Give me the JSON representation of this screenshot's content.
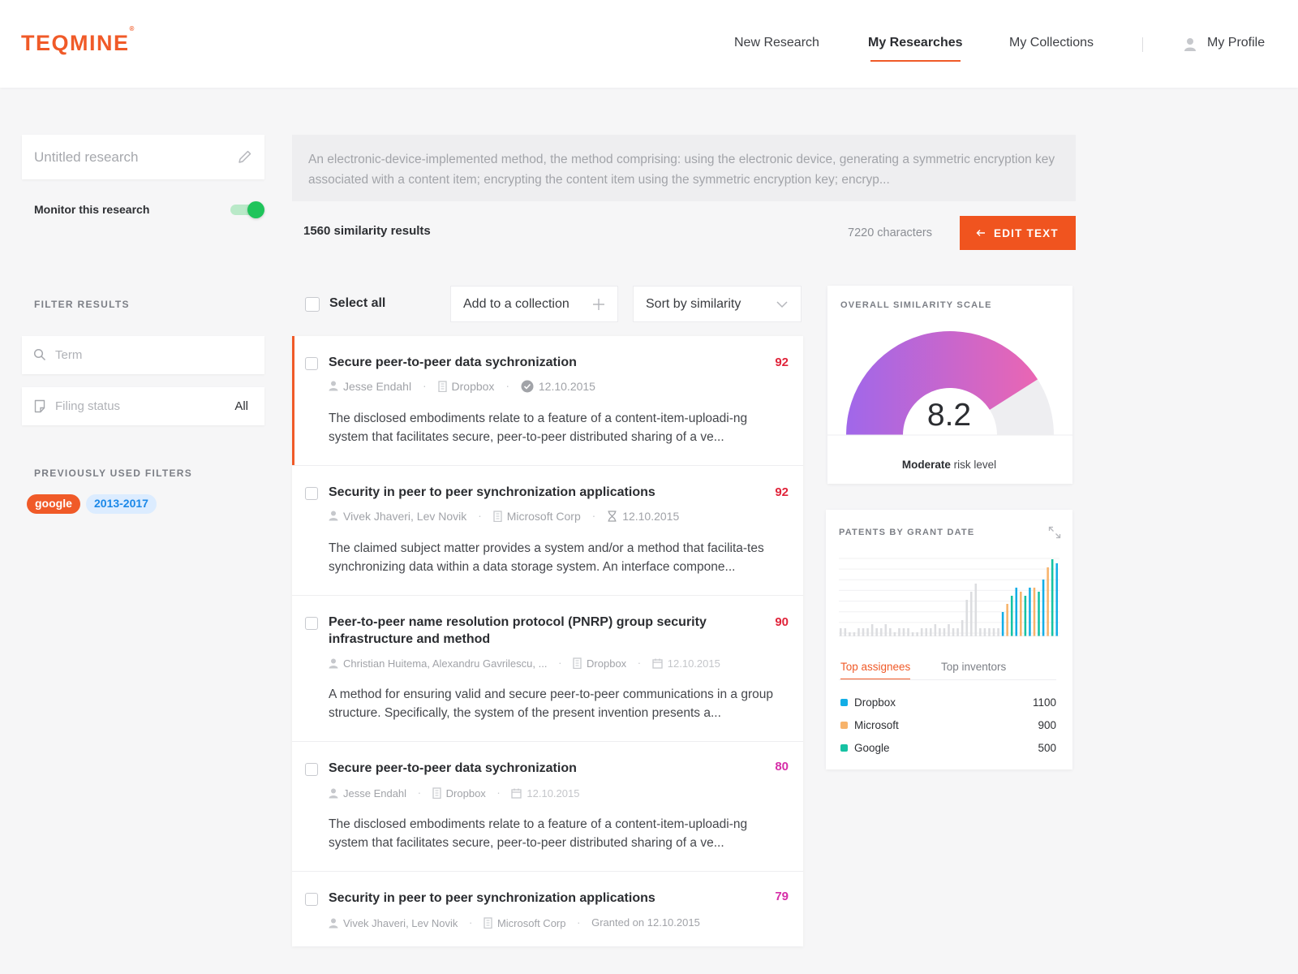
{
  "header": {
    "logo": "TEQMINE",
    "logo_mark": "®",
    "nav": [
      {
        "label": "New Research"
      },
      {
        "label": "My Researches"
      },
      {
        "label": "My Collections"
      },
      {
        "label": "My Profile"
      }
    ]
  },
  "sidebar": {
    "research_title_placeholder": "Untitled research",
    "monitor_label": "Monitor this research",
    "monitor_enabled": true,
    "filter_heading": "FILTER RESULTS",
    "term_placeholder": "Term",
    "filing_status_label": "Filing status",
    "filing_status_value": "All",
    "previous_filters_heading": "PREVIOUSLY USED FILTERS",
    "previous_filters": [
      "google",
      "2013-2017"
    ]
  },
  "query": {
    "text": "An electronic-device-implemented method, the method comprising: using the electronic device, generating a symmetric encryption key associated with a content item; encrypting the content item using the symmetric encryption key; encryp...",
    "results_count": "1560 similarity results",
    "characters": "7220 characters",
    "edit_button": "EDIT TEXT"
  },
  "toolbar": {
    "select_all": "Select all",
    "add_to_collection": "Add to a collection",
    "sort": "Sort by similarity"
  },
  "results": [
    {
      "title": "Secure peer-to-peer data sychronization",
      "score": "92",
      "authors": "Jesse Endahl",
      "company": "Dropbox",
      "date": "12.10.2015",
      "description": "The disclosed embodiments relate to a feature of a content-item-uploadi-ng system that facilitates secure, peer-to-peer distributed sharing of a ve..."
    },
    {
      "title": "Security in peer to peer synchronization applications",
      "score": "92",
      "authors": "Vivek Jhaveri, Lev Novik",
      "company": "Microsoft Corp",
      "date": "12.10.2015",
      "description": "The claimed subject matter provides a system and/or a method that facilita-tes synchronizing data within a data storage system. An interface compone..."
    },
    {
      "title": "Peer-to-peer name resolution protocol (PNRP) group security infrastructure and method",
      "score": "90",
      "authors": "Christian Huitema, Alexandru Gavrilescu, ...",
      "company": "Dropbox",
      "date": "12.10.2015",
      "description": "A method for ensuring valid and secure peer-to-peer communications in a group structure. Specifically, the system of the present invention presents a..."
    },
    {
      "title": "Secure peer-to-peer data sychronization",
      "score": "80",
      "authors": "Jesse Endahl",
      "company": "Dropbox",
      "date": "12.10.2015",
      "description": "The disclosed embodiments relate to a feature of a content-item-uploadi-ng system that facilitates secure, peer-to-peer distributed sharing of a ve..."
    },
    {
      "title": "Security in peer to peer synchronization applications",
      "score": "79",
      "authors": "Vivek Jhaveri, Lev Novik",
      "company": "Microsoft Corp",
      "date": "Granted on 12.10.2015",
      "description": ""
    }
  ],
  "similarity_card": {
    "title": "OVERALL SIMILARITY SCALE",
    "value": "8.2",
    "scale_max": 10,
    "risk_word": "Moderate",
    "risk_suffix": " risk level"
  },
  "patents_card": {
    "title": "PATENTS BY GRANT DATE",
    "tabs": [
      "Top assignees",
      "Top inventors"
    ],
    "assignees": [
      {
        "name": "Dropbox",
        "value": "1100",
        "color": "#13aee6"
      },
      {
        "name": "Microsoft",
        "value": "900",
        "color": "#f7b36b"
      },
      {
        "name": "Google",
        "value": "500",
        "color": "#16c2a3"
      }
    ]
  },
  "colors": {
    "accent": "#f05a28",
    "score_red": "#e0243a",
    "score_pink": "#d62ea8",
    "gauge_start": "#a067ea",
    "gauge_end": "#ea66b3"
  },
  "chart_data": {
    "type": "bar",
    "series": [
      {
        "values": [
          1,
          1,
          0.5,
          0.5,
          1,
          1,
          1,
          1.5,
          1,
          1,
          1.5,
          1,
          0.5,
          1,
          1,
          1,
          0.5,
          0.5,
          1,
          1,
          1,
          1.5,
          1,
          1,
          1.5,
          1,
          1,
          2,
          4.5,
          5.5,
          6.5,
          1,
          1,
          1,
          1,
          1,
          1,
          1
        ]
      },
      {
        "values": [
          0,
          0,
          0,
          0,
          0,
          0,
          0,
          0,
          0,
          0,
          0,
          0,
          0,
          0,
          0,
          0,
          0,
          0,
          0,
          0,
          0,
          0,
          0,
          0,
          0,
          0,
          0,
          0,
          0,
          0,
          0,
          0,
          0,
          0,
          0,
          0,
          3,
          4,
          5,
          6,
          5.5,
          5,
          6,
          6,
          5.5,
          7,
          8.5,
          9.5,
          9
        ]
      }
    ]
  }
}
